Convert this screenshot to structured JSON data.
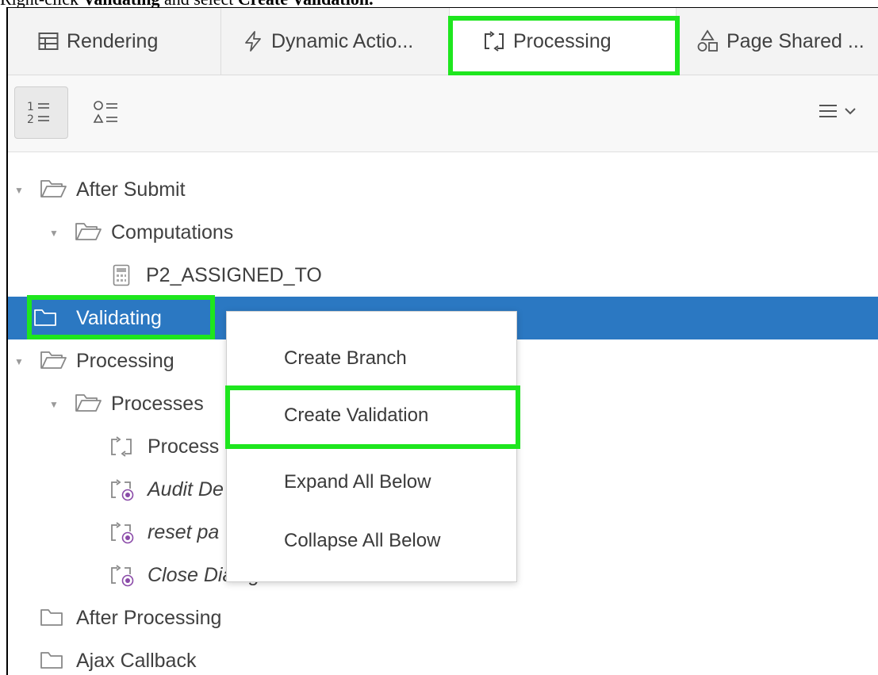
{
  "caption": {
    "prefix": "Right-click ",
    "target": "Validating",
    "middle": " and select ",
    "action": "Create Validation."
  },
  "tabs": [
    {
      "label": "Rendering",
      "icon": "table-icon"
    },
    {
      "label": "Dynamic Actio...",
      "icon": "lightning-icon"
    },
    {
      "label": "Processing",
      "icon": "processing-icon",
      "active": true
    },
    {
      "label": "Page Shared ...",
      "icon": "shapes-icon"
    }
  ],
  "toolbar": {
    "view_ordered": "numbered-list-icon",
    "view_grouped": "shapes-list-icon",
    "menu": "hamburger-menu-icon"
  },
  "tree": [
    {
      "label": "After Submit",
      "icon": "folder-open-icon"
    },
    {
      "label": "Computations",
      "icon": "folder-open-icon"
    },
    {
      "label": "P2_ASSIGNED_TO",
      "icon": "calculator-icon"
    },
    {
      "label": "Validating",
      "icon": "folder-icon",
      "selected": true
    },
    {
      "label": "Processing",
      "icon": "folder-open-icon"
    },
    {
      "label": "Processes",
      "icon": "folder-open-icon"
    },
    {
      "label": "Process",
      "icon": "process-icon"
    },
    {
      "label": "Audit De",
      "icon": "plugin-process-icon",
      "italic": true
    },
    {
      "label": "reset pa",
      "icon": "plugin-process-icon",
      "italic": true
    },
    {
      "label": "Close Dialog",
      "icon": "plugin-process-icon",
      "italic": true
    },
    {
      "label": "After Processing",
      "icon": "folder-icon"
    },
    {
      "label": "Ajax Callback",
      "icon": "folder-icon"
    }
  ],
  "context_menu": {
    "items": [
      "Create Branch",
      "Create Validation",
      "Expand All Below",
      "Collapse All Below"
    ]
  },
  "colors": {
    "highlight": "#1ee61e",
    "selection": "#2b78c2"
  }
}
